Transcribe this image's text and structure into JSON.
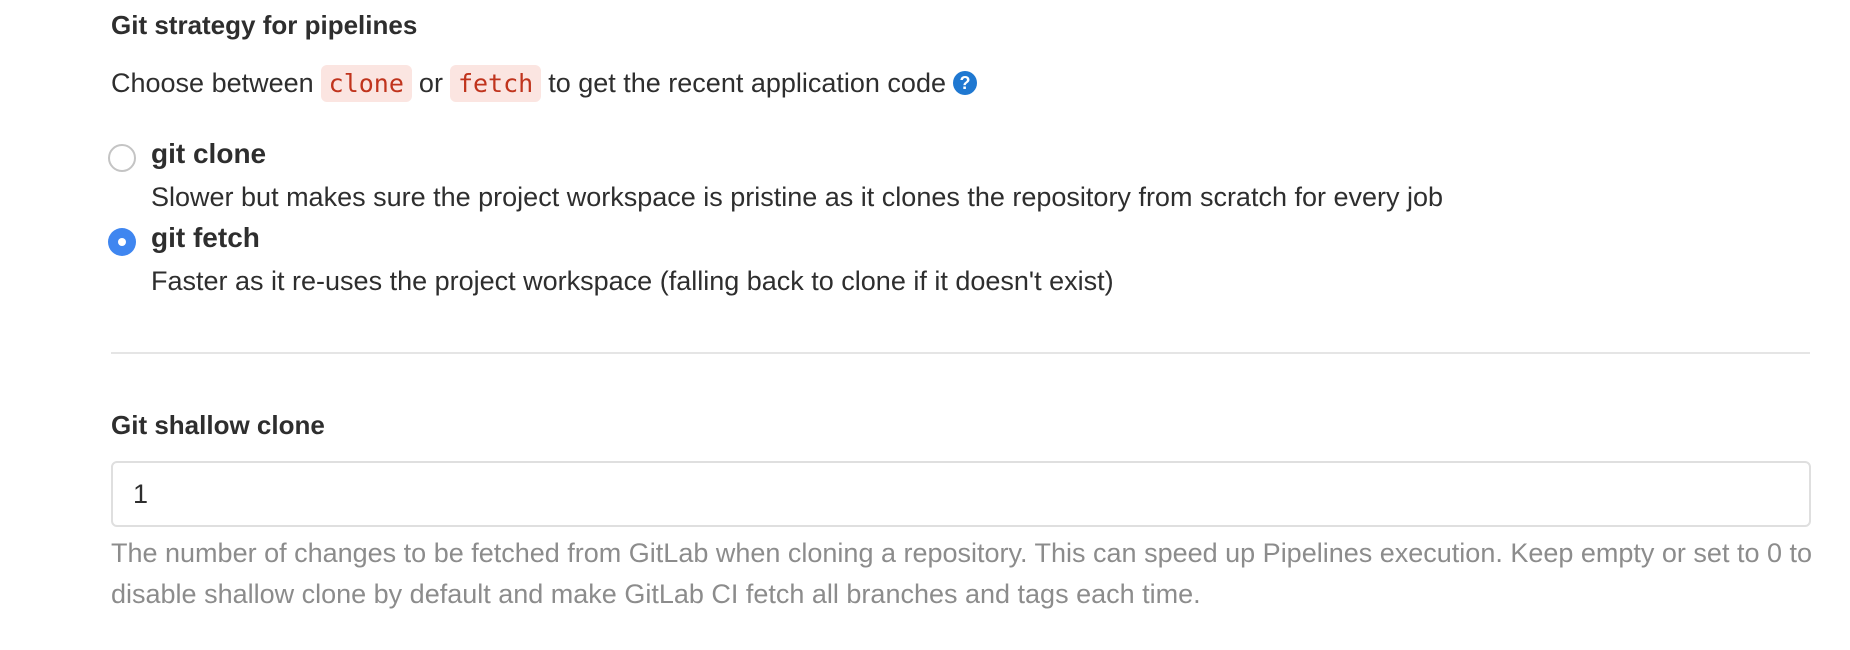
{
  "git_strategy": {
    "title": "Git strategy for pipelines",
    "description_prefix": "Choose between",
    "code_clone": "clone",
    "description_or": "or",
    "code_fetch": "fetch",
    "description_suffix": "to get the recent application code",
    "help_icon": "question-circle-icon",
    "help_icon_glyph": "?",
    "options": [
      {
        "label": "git clone",
        "help": "Slower but makes sure the project workspace is pristine as it clones the repository from scratch for every job",
        "checked": false
      },
      {
        "label": "git fetch",
        "help": "Faster as it re-uses the project workspace (falling back to clone if it doesn't exist)",
        "checked": true
      }
    ]
  },
  "shallow_clone": {
    "title": "Git shallow clone",
    "value": "1",
    "help": "The number of changes to be fetched from GitLab when cloning a repository. This can speed up Pipelines execution. Keep empty or set to 0 to disable shallow clone by default and make GitLab CI fetch all branches and tags each time."
  },
  "colors": {
    "accent": "#1f78d1",
    "radio_checked": "#3f86f0",
    "code_text": "#c0341d",
    "code_bg": "#fbe5e1",
    "muted_text": "#8c8c8c"
  }
}
